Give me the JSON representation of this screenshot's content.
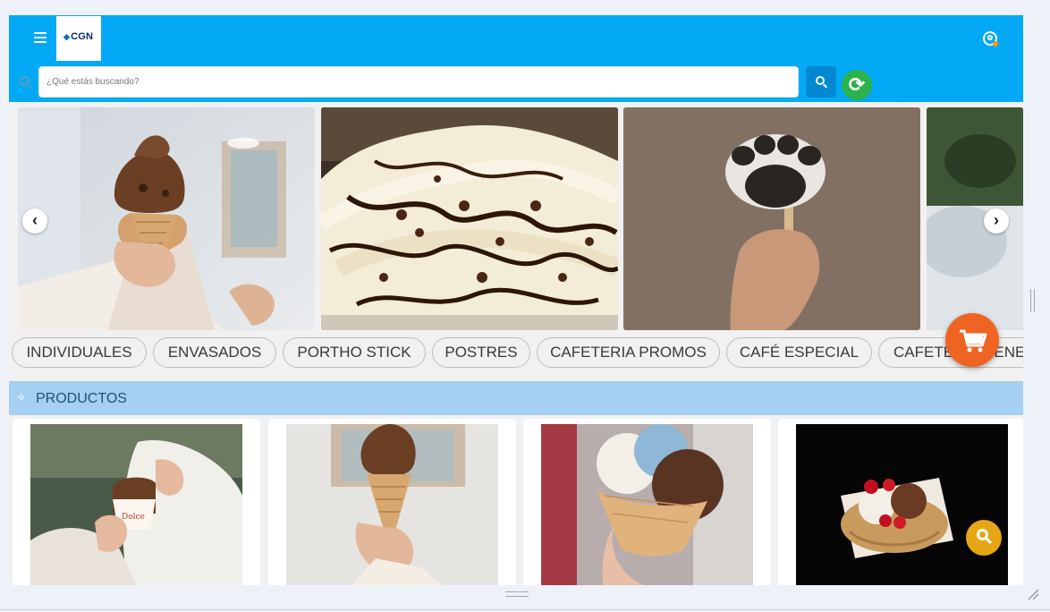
{
  "header": {
    "logo_text": "CGN"
  },
  "search": {
    "placeholder": "¿Qué estás buscando?"
  },
  "carousel": {
    "prev_glyph": "‹",
    "next_glyph": "›",
    "slides": [
      "chocolate-ice-cream-cone",
      "soft-serve-with-chocolate-sauce",
      "paw-shaped-chocolate-popsicle",
      "partial-fourth-slide"
    ]
  },
  "categories": [
    "INDIVIDUALES",
    "ENVASADOS",
    "PORTHO STICK",
    "POSTRES",
    "CAFETERIA PROMOS",
    "CAFÉ ESPECIAL",
    "CAFETERIA GENERAL"
  ],
  "section": {
    "icon": "sparkle-icon",
    "title": "PRODUCTOS"
  },
  "products": [
    "ice-cream-cup",
    "chocolate-cone",
    "two-scoop-cone",
    "sundae-with-cherries"
  ],
  "colors": {
    "header_blue": "#03a9f4",
    "search_button_blue": "#0288d1",
    "refresh_green": "#2bb24c",
    "section_bar": "#a6d0f1",
    "cart_orange": "#f06423",
    "zoom_yellow": "#e6a616"
  }
}
